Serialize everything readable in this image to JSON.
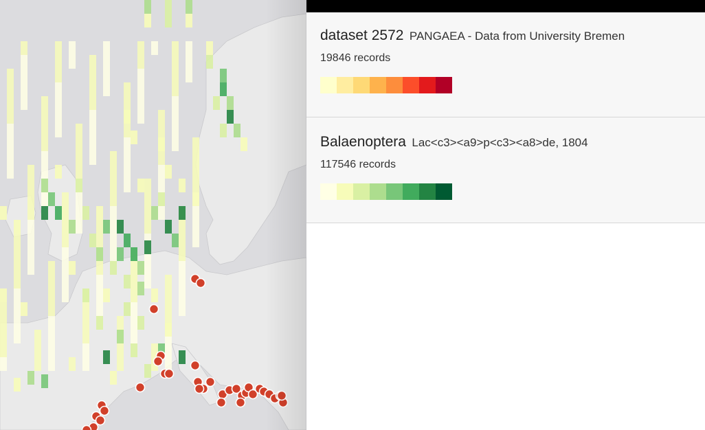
{
  "map": {
    "dot_color": "#d1402a",
    "land_color": "#eaeaea",
    "sea_color": "#dcdcdf"
  },
  "layers": [
    {
      "title": "dataset 2572",
      "source": "PANGAEA - Data from University Bremen",
      "count": "19846 records",
      "ramp": [
        "#ffffcc",
        "#ffeda0",
        "#fed976",
        "#feb24c",
        "#fd8d3c",
        "#fc4e2a",
        "#e31a1c",
        "#b10026"
      ]
    },
    {
      "title": "Balaenoptera",
      "source": "Lac<c3><a9>p<c3><a8>de, 1804",
      "count": "117546 records",
      "ramp": [
        "#ffffe5",
        "#f7fcb9",
        "#d9f0a3",
        "#addd8e",
        "#78c679",
        "#41ab5d",
        "#238443",
        "#005a32"
      ]
    }
  ]
}
